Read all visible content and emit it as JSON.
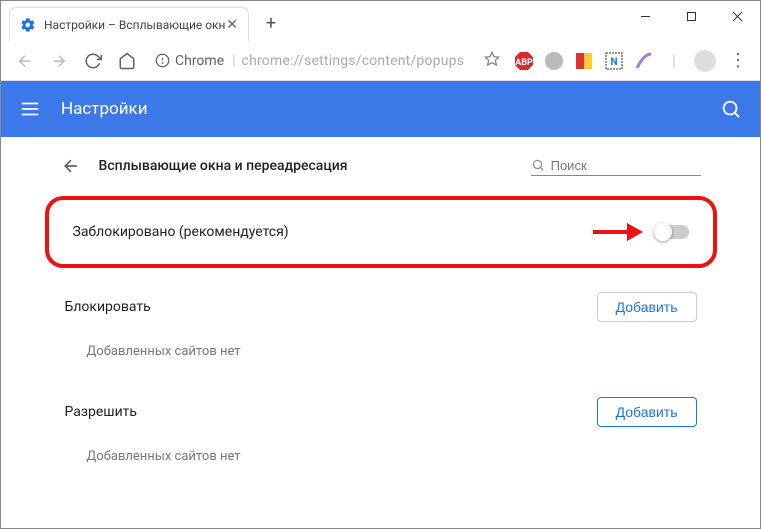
{
  "window": {
    "tab_title": "Настройки – Всплывающие окн",
    "minimize": "—",
    "maximize": "☐",
    "close": "✕"
  },
  "address": {
    "secure_label": "Chrome",
    "url": "chrome://settings/content/popups"
  },
  "header": {
    "title": "Настройки"
  },
  "page": {
    "title": "Всплывающие окна и переадресация",
    "search_placeholder": "Поиск",
    "toggle_label": "Заблокировано (рекомендуется)",
    "block_section": "Блокировать",
    "block_empty": "Добавленных сайтов нет",
    "allow_section": "Разрешить",
    "allow_empty": "Добавленных сайтов нет",
    "add_btn": "Добавить"
  }
}
